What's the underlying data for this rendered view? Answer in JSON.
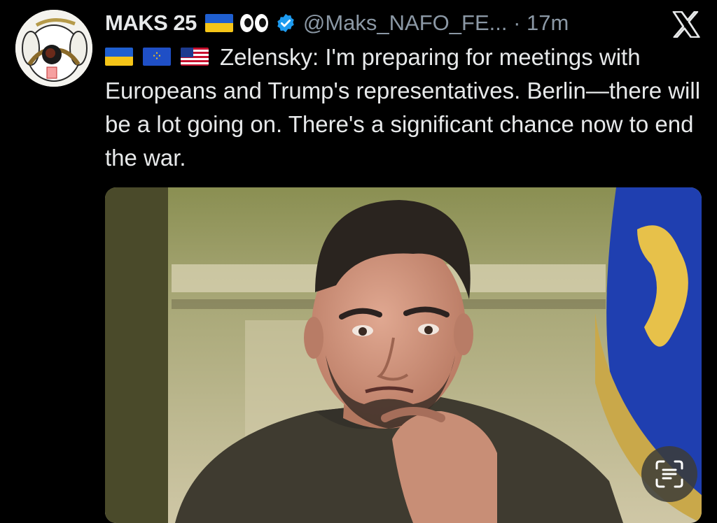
{
  "tweet": {
    "author_name": "MAKS 25",
    "handle": "@Maks_NAFO_FE...",
    "separator": "·",
    "time": "17m",
    "text": "Zelensky: I'm preparing for meetings with Europeans and Trump's representatives. Berlin—there will be a lot going on. There's a significant chance now to end the war."
  },
  "icons": {
    "platform": "x-logo-icon",
    "verified": "verified-badge-icon",
    "flags": [
      "ukraine-flag-icon",
      "eu-flag-icon",
      "us-flag-icon"
    ],
    "emoji_eyes": "eyes-icon",
    "lens": "visual-lookup-icon"
  },
  "colors": {
    "background": "#000000",
    "text": "#e7e9ea",
    "muted": "#8b98a5",
    "verified": "#1d9bf0"
  }
}
